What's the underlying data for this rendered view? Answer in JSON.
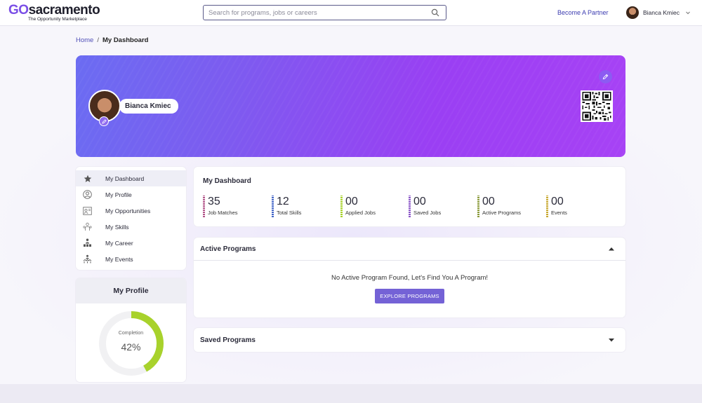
{
  "header": {
    "logo_go": "GO",
    "logo_rest": "sacramento",
    "logo_tagline": "The Opportunity Marketplace",
    "search_placeholder": "Search for programs, jobs or careers",
    "partner_link": "Become A Partner",
    "user_name": "Bianca Kmiec"
  },
  "breadcrumb": {
    "home": "Home",
    "separator": "/",
    "current": "My Dashboard"
  },
  "banner": {
    "name": "Bianca Kmiec",
    "gradient_colors": [
      "#6b6cf2",
      "#a742f5"
    ]
  },
  "sidebar": {
    "items": [
      {
        "label": "My Dashboard",
        "icon": "star-icon",
        "active": true
      },
      {
        "label": "My Profile",
        "icon": "user-circle-icon",
        "active": false
      },
      {
        "label": "My Opportunities",
        "icon": "opportunities-icon",
        "active": false
      },
      {
        "label": "My Skills",
        "icon": "skills-icon",
        "active": false
      },
      {
        "label": "My Career",
        "icon": "career-icon",
        "active": false
      },
      {
        "label": "My Events",
        "icon": "events-icon",
        "active": false
      }
    ]
  },
  "profile_card": {
    "title": "My Profile",
    "completion_label": "Completion",
    "completion_text": "42%",
    "completion_fraction": 0.42,
    "ring_color": "#a8d22c"
  },
  "dashboard": {
    "title": "My Dashboard",
    "stats": [
      {
        "value": "35",
        "label": "Job Matches",
        "color": "#b3558a"
      },
      {
        "value": "12",
        "label": "Total Skills",
        "color": "#4466c8"
      },
      {
        "value": "00",
        "label": "Applied Jobs",
        "color": "#a8d22c"
      },
      {
        "value": "00",
        "label": "Saved Jobs",
        "color": "#8a55c8"
      },
      {
        "value": "00",
        "label": "Active Programs",
        "color": "#8a9a3a"
      },
      {
        "value": "00",
        "label": "Events",
        "color": "#c8a830"
      }
    ]
  },
  "active_programs": {
    "title": "Active Programs",
    "empty_message": "No Active Program Found, Let's Find You A Program!",
    "button_label": "EXPLORE PROGRAMS",
    "button_color": "#7462d6"
  },
  "saved_programs": {
    "title": "Saved Programs"
  }
}
